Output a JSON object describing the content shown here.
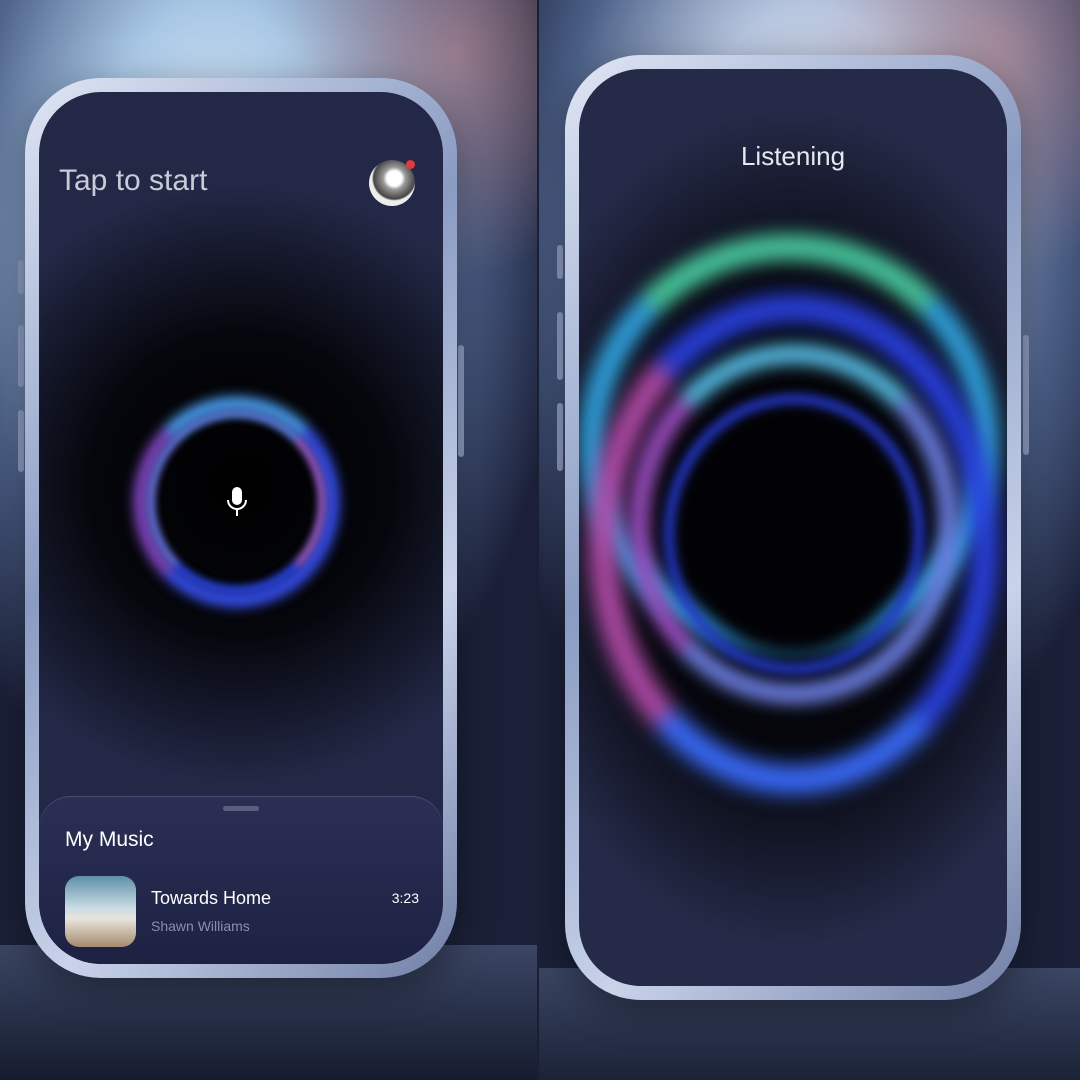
{
  "left_screen": {
    "title": "Tap to start",
    "avatar_icon": "user-avatar",
    "notification_color": "#e23b3b",
    "center_icon": "microphone-icon",
    "music_card": {
      "heading": "My Music",
      "track": {
        "title": "Towards Home",
        "artist": "Shawn Williams",
        "duration": "3:23"
      }
    }
  },
  "right_screen": {
    "status": "Listening"
  }
}
